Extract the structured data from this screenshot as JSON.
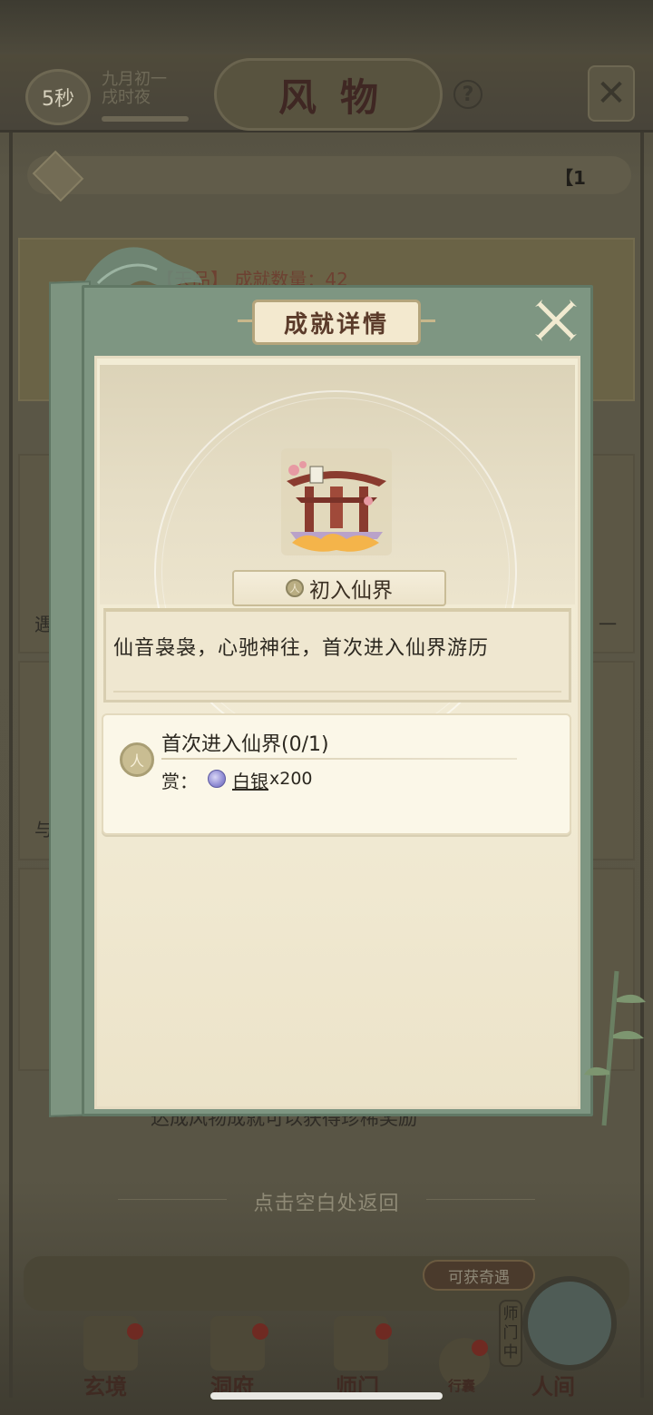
{
  "background": {
    "timer": "5秒",
    "date_line1": "九月初一",
    "date_line2": "戌时夜",
    "page_title": "风物",
    "help": "?",
    "marquee": "【1",
    "achievement_summary": "【天品】 成就数量：42",
    "row_texts": [
      "遇",
      "一",
      "与"
    ],
    "footer_tip": "达成风物成就可以获得珍稀奖励",
    "back_hint": "点击空白处返回",
    "encounter_label": "可获奇遇",
    "shimen_tag": "师门中",
    "nav": [
      "玄境",
      "洞府",
      "师门",
      "行囊",
      "人间"
    ]
  },
  "modal": {
    "header": "成就详情",
    "achievement_name": "初入仙界",
    "rank_symbol": "人",
    "description": "仙音袅袅，心驰神往，首次进入仙界游历",
    "task": {
      "title": "首次进入仙界(0/1)",
      "badge": "人",
      "reward_label": "赏：",
      "reward_item": "白银",
      "reward_qty": "x200"
    }
  },
  "colors": {
    "modal_green": "#7e9682",
    "panel_cream": "#f2ecd5",
    "title_brown": "#5b3b2a",
    "silver_coin": "#8f8bd3"
  }
}
